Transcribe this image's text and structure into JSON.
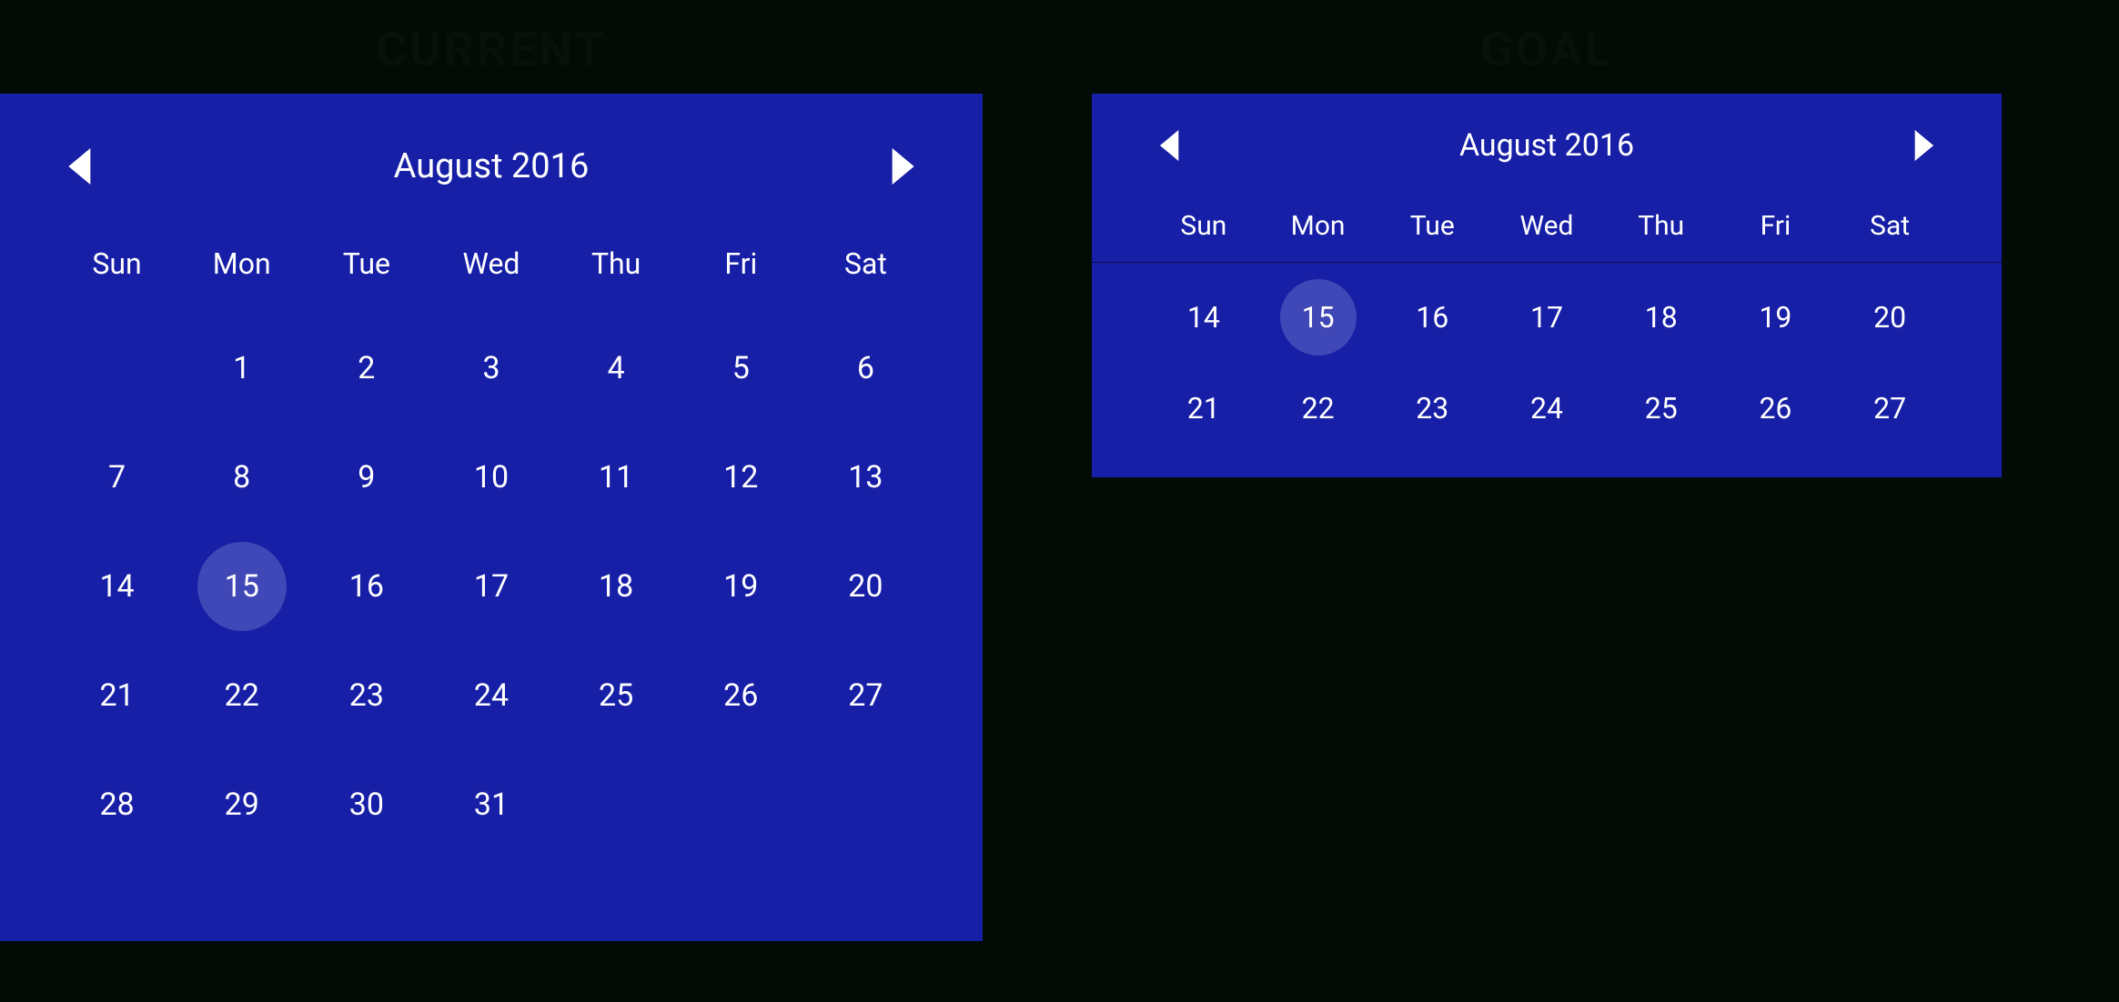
{
  "labels": {
    "current": "CURRENT",
    "goal": "GOAL"
  },
  "dow": {
    "sun": "Sun",
    "mon": "Mon",
    "tue": "Tue",
    "wed": "Wed",
    "thu": "Thu",
    "fri": "Fri",
    "sat": "Sat"
  },
  "full": {
    "title": "August 2016",
    "selected": 15,
    "weeks": {
      "r0": {
        "c0": "",
        "c1": "1",
        "c2": "2",
        "c3": "3",
        "c4": "4",
        "c5": "5",
        "c6": "6"
      },
      "r1": {
        "c0": "7",
        "c1": "8",
        "c2": "9",
        "c3": "10",
        "c4": "11",
        "c5": "12",
        "c6": "13"
      },
      "r2": {
        "c0": "14",
        "c1": "15",
        "c2": "16",
        "c3": "17",
        "c4": "18",
        "c5": "19",
        "c6": "20"
      },
      "r3": {
        "c0": "21",
        "c1": "22",
        "c2": "23",
        "c3": "24",
        "c4": "25",
        "c5": "26",
        "c6": "27"
      },
      "r4": {
        "c0": "28",
        "c1": "29",
        "c2": "30",
        "c3": "31",
        "c4": "",
        "c5": "",
        "c6": ""
      }
    }
  },
  "compact": {
    "title": "August 2016",
    "selected": 15,
    "weeks": {
      "r0": {
        "c0": "14",
        "c1": "15",
        "c2": "16",
        "c3": "17",
        "c4": "18",
        "c5": "19",
        "c6": "20"
      },
      "r1": {
        "c0": "21",
        "c1": "22",
        "c2": "23",
        "c3": "24",
        "c4": "25",
        "c5": "26",
        "c6": "27"
      }
    }
  }
}
